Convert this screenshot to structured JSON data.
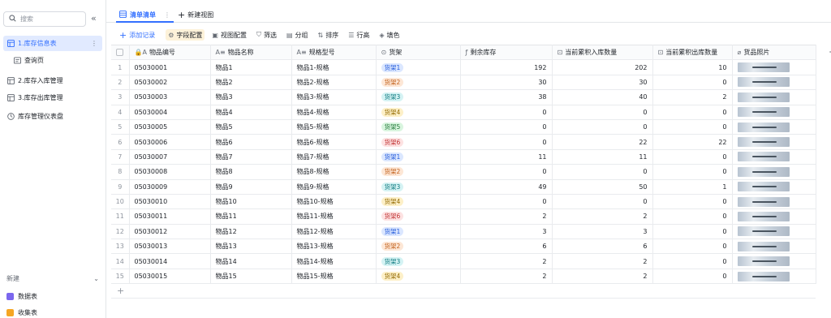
{
  "sidebar": {
    "search_placeholder": "搜索",
    "collapse_icon": "«",
    "items": [
      {
        "label": "1.库存信息表"
      },
      {
        "label": "查询页"
      },
      {
        "label": "2.库存入库管理"
      },
      {
        "label": "3.库存出库管理"
      },
      {
        "label": "库存管理仪表盘"
      }
    ],
    "new_label": "新建",
    "new_items": [
      {
        "label": "数据表",
        "color": "#7b67ee"
      },
      {
        "label": "收集表",
        "color": "#f5a623"
      }
    ]
  },
  "tabs": {
    "active_tab": "清单清单",
    "new_view": "新建视图"
  },
  "toolbar": {
    "add_record": "添加记录",
    "field_config": "字段配置",
    "view_config": "视图配置",
    "filter": "筛选",
    "group": "分组",
    "sort": "排序",
    "row_height": "行高",
    "fill_color": "填色"
  },
  "table": {
    "headers": [
      "物品编号",
      "物品名称",
      "规格型号",
      "货架",
      "剩余库存",
      "当前累积入库数量",
      "当前累积出库数量",
      "货品照片"
    ],
    "rows": [
      {
        "idx": "1",
        "code": "05030001",
        "name": "物品1",
        "spec": "物品1-规格",
        "shelf": "货架1",
        "stock": "192",
        "in": "202",
        "out": "10"
      },
      {
        "idx": "2",
        "code": "05030002",
        "name": "物品2",
        "spec": "物品2-规格",
        "shelf": "货架2",
        "stock": "30",
        "in": "30",
        "out": "0"
      },
      {
        "idx": "3",
        "code": "05030003",
        "name": "物品3",
        "spec": "物品3-规格",
        "shelf": "货架3",
        "stock": "38",
        "in": "40",
        "out": "2"
      },
      {
        "idx": "4",
        "code": "05030004",
        "name": "物品4",
        "spec": "物品4-规格",
        "shelf": "货架4",
        "stock": "0",
        "in": "0",
        "out": "0"
      },
      {
        "idx": "5",
        "code": "05030005",
        "name": "物品5",
        "spec": "物品5-规格",
        "shelf": "货架5",
        "stock": "0",
        "in": "0",
        "out": "0"
      },
      {
        "idx": "6",
        "code": "05030006",
        "name": "物品6",
        "spec": "物品6-规格",
        "shelf": "货架6",
        "stock": "0",
        "in": "22",
        "out": "22"
      },
      {
        "idx": "7",
        "code": "05030007",
        "name": "物品7",
        "spec": "物品7-规格",
        "shelf": "货架1",
        "stock": "11",
        "in": "11",
        "out": "0"
      },
      {
        "idx": "8",
        "code": "05030008",
        "name": "物品8",
        "spec": "物品8-规格",
        "shelf": "货架2",
        "stock": "0",
        "in": "0",
        "out": "0"
      },
      {
        "idx": "9",
        "code": "05030009",
        "name": "物品9",
        "spec": "物品9-规格",
        "shelf": "货架3",
        "stock": "49",
        "in": "50",
        "out": "1"
      },
      {
        "idx": "10",
        "code": "05030010",
        "name": "物品10",
        "spec": "物品10-规格",
        "shelf": "货架4",
        "stock": "0",
        "in": "0",
        "out": "0"
      },
      {
        "idx": "11",
        "code": "05030011",
        "name": "物品11",
        "spec": "物品11-规格",
        "shelf": "货架6",
        "stock": "2",
        "in": "2",
        "out": "0"
      },
      {
        "idx": "12",
        "code": "05030012",
        "name": "物品12",
        "spec": "物品12-规格",
        "shelf": "货架1",
        "stock": "3",
        "in": "3",
        "out": "0"
      },
      {
        "idx": "13",
        "code": "05030013",
        "name": "物品13",
        "spec": "物品13-规格",
        "shelf": "货架2",
        "stock": "6",
        "in": "6",
        "out": "0"
      },
      {
        "idx": "14",
        "code": "05030014",
        "name": "物品14",
        "spec": "物品14-规格",
        "shelf": "货架3",
        "stock": "2",
        "in": "2",
        "out": "0"
      },
      {
        "idx": "15",
        "code": "05030015",
        "name": "物品15",
        "spec": "物品15-规格",
        "shelf": "货架4",
        "stock": "2",
        "in": "2",
        "out": "0"
      }
    ],
    "shelf_colors": {
      "货架1": {
        "bg": "#dbe7ff",
        "fg": "#245bdb"
      },
      "货架2": {
        "bg": "#fde7d6",
        "fg": "#c2611c"
      },
      "货架3": {
        "bg": "#d5f3f4",
        "fg": "#0f7b80"
      },
      "货架4": {
        "bg": "#fdf0c8",
        "fg": "#946a00"
      },
      "货架5": {
        "bg": "#d9f5df",
        "fg": "#237a3a"
      },
      "货架6": {
        "bg": "#fde2e2",
        "fg": "#c13333"
      }
    }
  }
}
